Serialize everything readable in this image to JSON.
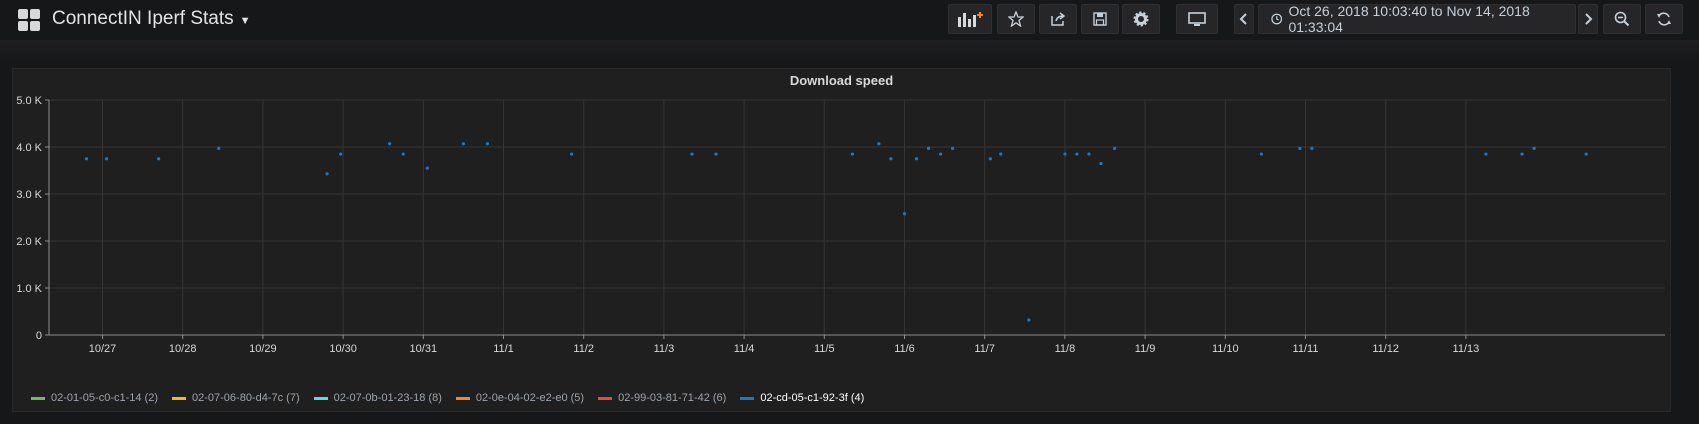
{
  "header": {
    "title": "ConnectIN Iperf Stats",
    "time_range": "Oct 26, 2018 10:03:40 to Nov 14, 2018 01:33:04"
  },
  "toolbar": {
    "add_panel_icon": "add-panel-icon",
    "star_icon": "star-icon",
    "share_icon": "share-icon",
    "save_icon": "save-icon",
    "settings_icon": "gear-icon",
    "tv_icon": "monitor-icon",
    "back_icon": "chevron-left-icon",
    "forward_icon": "chevron-right-icon",
    "zoom_icon": "zoom-out-icon",
    "refresh_icon": "refresh-icon",
    "clock_icon": "clock-icon"
  },
  "panel": {
    "title": "Download speed"
  },
  "legend": [
    {
      "label": "02-01-05-c0-c1-14 (2)",
      "color": "#7eb26d"
    },
    {
      "label": "02-07-06-80-d4-7c (7)",
      "color": "#eab839"
    },
    {
      "label": "02-07-0b-01-23-18 (8)",
      "color": "#6ed0e0"
    },
    {
      "label": "02-0e-04-02-e2-e0 (5)",
      "color": "#ef843c"
    },
    {
      "label": "02-99-03-81-71-42 (6)",
      "color": "#e24d42"
    },
    {
      "label": "02-cd-05-c1-92-3f (4)",
      "color": "#1f78c1",
      "active": true
    }
  ],
  "chart_data": {
    "type": "scatter",
    "title": "Download speed",
    "x_tick_labels": [
      "10/27",
      "10/28",
      "10/29",
      "10/30",
      "10/31",
      "11/1",
      "11/2",
      "11/3",
      "11/4",
      "11/5",
      "11/6",
      "11/7",
      "11/8",
      "11/9",
      "11/10",
      "11/11",
      "11/12",
      "11/13"
    ],
    "y_tick_labels": [
      "0",
      "1.0 K",
      "2.0 K",
      "3.0 K",
      "4.0 K",
      "5.0 K"
    ],
    "ylim": [
      0,
      5000
    ],
    "xlim_days": [
      -0.3,
      18.05
    ],
    "grid": true,
    "series": [
      {
        "name": "02-cd-05-c1-92-3f (4)",
        "color": "#1f78c1",
        "points": [
          {
            "d": -0.2,
            "v": 3750
          },
          {
            "d": 0.05,
            "v": 3750
          },
          {
            "d": 0.7,
            "v": 3750
          },
          {
            "d": 1.45,
            "v": 3970
          },
          {
            "d": 2.8,
            "v": 3430
          },
          {
            "d": 2.97,
            "v": 3850
          },
          {
            "d": 3.58,
            "v": 4070
          },
          {
            "d": 3.75,
            "v": 3850
          },
          {
            "d": 4.05,
            "v": 3550
          },
          {
            "d": 4.5,
            "v": 4070
          },
          {
            "d": 4.8,
            "v": 4070
          },
          {
            "d": 5.85,
            "v": 3850
          },
          {
            "d": 7.35,
            "v": 3850
          },
          {
            "d": 7.65,
            "v": 3850
          },
          {
            "d": 9.35,
            "v": 3850
          },
          {
            "d": 9.68,
            "v": 4070
          },
          {
            "d": 9.83,
            "v": 3750
          },
          {
            "d": 10.0,
            "v": 2580
          },
          {
            "d": 10.15,
            "v": 3750
          },
          {
            "d": 10.3,
            "v": 3970
          },
          {
            "d": 10.45,
            "v": 3850
          },
          {
            "d": 10.6,
            "v": 3970
          },
          {
            "d": 11.07,
            "v": 3750
          },
          {
            "d": 11.2,
            "v": 3850
          },
          {
            "d": 11.55,
            "v": 320
          },
          {
            "d": 12.0,
            "v": 3850
          },
          {
            "d": 12.15,
            "v": 3850
          },
          {
            "d": 12.3,
            "v": 3850
          },
          {
            "d": 12.45,
            "v": 3650
          },
          {
            "d": 12.62,
            "v": 3970
          },
          {
            "d": 14.45,
            "v": 3850
          },
          {
            "d": 14.93,
            "v": 3970
          },
          {
            "d": 15.08,
            "v": 3970
          },
          {
            "d": 17.25,
            "v": 3850
          },
          {
            "d": 17.7,
            "v": 3850
          },
          {
            "d": 17.85,
            "v": 3970
          },
          {
            "d": 18.5,
            "v": 3850
          }
        ]
      }
    ]
  }
}
